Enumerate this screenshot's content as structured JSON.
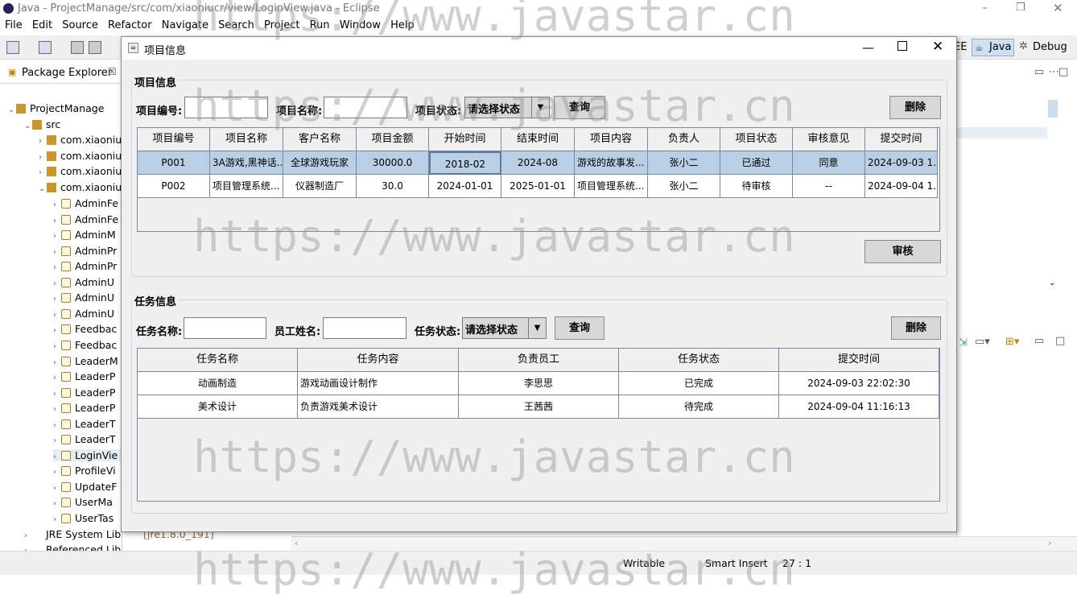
{
  "window_title": "Java - ProjectManage/src/com/xiaoniucr/view/LoginView.java - Eclipse",
  "menu": [
    "File",
    "Edit",
    "Source",
    "Refactor",
    "Navigate",
    "Search",
    "Project",
    "Run",
    "Window",
    "Help"
  ],
  "perspectives": {
    "ee": "EE",
    "java": "Java",
    "debug": "Debug"
  },
  "package_explorer": {
    "tab_label": "Package Explorer",
    "project": "ProjectManage",
    "src": "src",
    "packages": [
      "com.xiaoniu",
      "com.xiaoniu",
      "com.xiaoniu",
      "com.xiaoniu"
    ],
    "files": [
      "AdminFe",
      "AdminFe",
      "AdminM",
      "AdminPr",
      "AdminPr",
      "AdminU",
      "AdminU",
      "AdminU",
      "Feedbac",
      "Feedbac",
      "LeaderM",
      "LeaderP",
      "LeaderP",
      "LeaderP",
      "LeaderT",
      "LeaderT",
      "LoginVie",
      "ProfileVi",
      "UpdateF",
      "UserMa",
      "UserTas"
    ],
    "jre": "JRE System Library",
    "jre_version": "[jre1.8.0_191]",
    "ref": "Referenced Libraries"
  },
  "status_bar": {
    "writable": "Writable",
    "insert": "Smart Insert",
    "position": "27 : 1"
  },
  "dialog": {
    "title": "项目信息",
    "project_section": {
      "title": "项目信息",
      "labels": {
        "code": "项目编号:",
        "name": "项目名称:",
        "status": "项目状态:"
      },
      "code_value": "",
      "name_value": "",
      "status_selected": "请选择状态",
      "search_button": "查询",
      "delete_button": "删除",
      "audit_button": "审核",
      "columns": [
        "项目编号",
        "项目名称",
        "客户名称",
        "项目金额",
        "开始时间",
        "结束时间",
        "项目内容",
        "负责人",
        "项目状态",
        "审核意见",
        "提交时间"
      ],
      "rows": [
        [
          "P001",
          "3A游戏,黑神话...",
          "全球游戏玩家",
          "30000.0",
          "2018-02",
          "2024-08",
          "游戏的故事发...",
          "张小二",
          "已通过",
          "同意",
          "2024-09-03 1..."
        ],
        [
          "P002",
          "项目管理系统...",
          "仪器制造厂",
          "30.0",
          "2024-01-01",
          "2025-01-01",
          "项目管理系统...",
          "张小二",
          "待审核",
          "--",
          "2024-09-04 1..."
        ]
      ]
    },
    "task_section": {
      "title": "任务信息",
      "labels": {
        "name": "任务名称:",
        "employee": "员工姓名:",
        "status": "任务状态:"
      },
      "name_value": "",
      "employee_value": "",
      "status_selected": "请选择状态",
      "search_button": "查询",
      "delete_button": "删除",
      "columns": [
        "任务名称",
        "任务内容",
        "负责员工",
        "任务状态",
        "提交时间"
      ],
      "rows": [
        [
          "动画制造",
          "游戏动画设计制作",
          "李思思",
          "已完成",
          "2024-09-03 22:02:30"
        ],
        [
          "美术设计",
          "负责游戏美术设计",
          "王茜茜",
          "待完成",
          "2024-09-04 11:16:13"
        ]
      ]
    }
  },
  "watermark": "https://www.javastar.cn"
}
